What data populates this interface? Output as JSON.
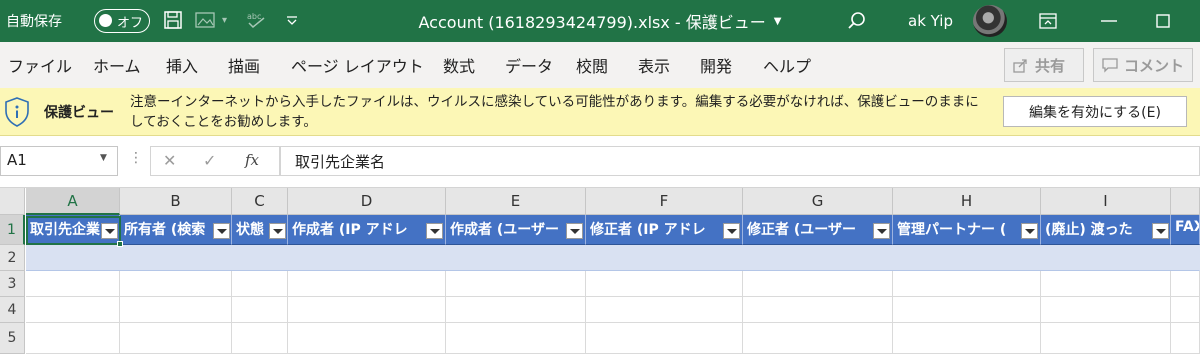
{
  "titlebar": {
    "autosave_label": "自動保存",
    "autosave_state": "オフ",
    "document_title": "Account (1618293424799).xlsx - 保護ビュー",
    "user_name": "ak Yip",
    "colors": {
      "background": "#217346",
      "text": "#ffffff"
    }
  },
  "menu": {
    "items": [
      "ファイル",
      "ホーム",
      "挿入",
      "描画",
      "ページ レイアウト",
      "数式",
      "データ",
      "校閲",
      "表示",
      "開発",
      "ヘルプ"
    ],
    "share_label": "共有",
    "comment_label": "コメント"
  },
  "protected_view": {
    "title": "保護ビュー",
    "message": "注意ーインターネットから入手したファイルは、ウイルスに感染している可能性があります。編集する必要がなければ、保護ビューのままにしておくことをお勧めします。",
    "enable_button": "編集を有効にする(E)",
    "colors": {
      "background": "#fcf7b6"
    }
  },
  "formula_bar": {
    "name_box": "A1",
    "formula": "取引先企業名"
  },
  "sheet": {
    "columns": [
      "A",
      "B",
      "C",
      "D",
      "E",
      "F",
      "G",
      "H",
      "I"
    ],
    "selected_column": "A",
    "rows": [
      "1",
      "2",
      "3",
      "4",
      "5"
    ],
    "selected_row": "1",
    "header_cells": [
      "取引先企業",
      "所有者 (検索",
      "状態",
      "作成者 (IP アドレ",
      "作成者 (ユーザー",
      "修正者 (IP アドレ",
      "修正者 (ユーザー",
      "管理パートナー (",
      "(廃止) 渡った",
      "FAX"
    ],
    "colors": {
      "table_header": "#4472c4",
      "band_row": "#d9e1f2",
      "selection": "#217346"
    }
  }
}
